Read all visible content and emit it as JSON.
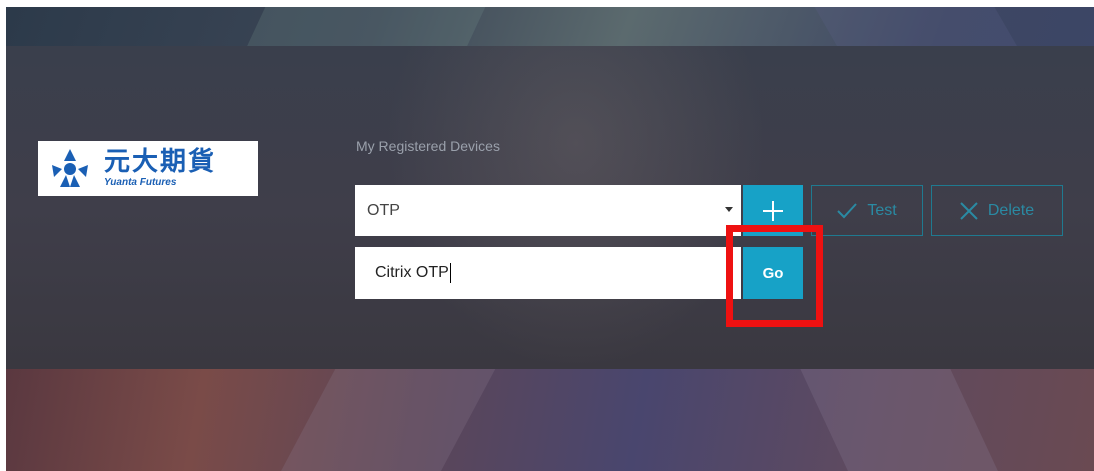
{
  "brand": {
    "name_cn": "元大期貨",
    "name_en": "Yuanta Futures",
    "logo_color": "#1a5fb4"
  },
  "devices": {
    "label": "My Registered Devices",
    "selected": "OTP",
    "add_icon": "plus-icon",
    "test_label": "Test",
    "test_icon": "check-icon",
    "delete_label": "Delete",
    "delete_icon": "x-icon"
  },
  "otp_name": {
    "value": "Citrix OTP",
    "go_label": "Go"
  },
  "colors": {
    "accent": "#17a2c7",
    "outline": "#1f7a90",
    "highlight": "#ee1111"
  }
}
